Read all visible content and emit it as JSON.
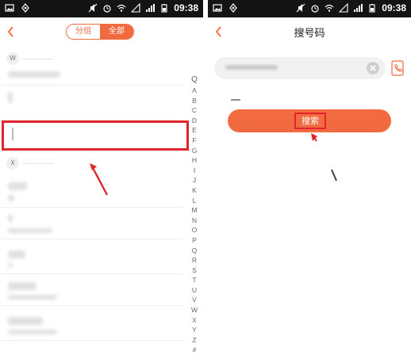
{
  "status_bar": {
    "time": "09:38",
    "network": "3G"
  },
  "left_screen": {
    "segment": {
      "groups_label": "分组",
      "all_label": "全部",
      "selected": "全部"
    },
    "sections": [
      {
        "letter": "W"
      },
      {
        "letter": "X"
      }
    ],
    "index_bar": [
      "Q",
      "A",
      "B",
      "C",
      "D",
      "E",
      "F",
      "G",
      "H",
      "I",
      "J",
      "K",
      "L",
      "M",
      "N",
      "O",
      "P",
      "Q",
      "R",
      "S",
      "T",
      "U",
      "V",
      "W",
      "X",
      "Y",
      "Z",
      "#"
    ]
  },
  "right_screen": {
    "title": "搜号码",
    "search_button_label": "搜索"
  },
  "colors": {
    "accent": "#f26b40",
    "highlight": "#e0262c",
    "status_bar": "#141414"
  },
  "icons": [
    "back-icon",
    "clear-icon",
    "contact-book-icon",
    "alarm-icon",
    "wifi-icon",
    "signal-icon",
    "battery-icon"
  ]
}
